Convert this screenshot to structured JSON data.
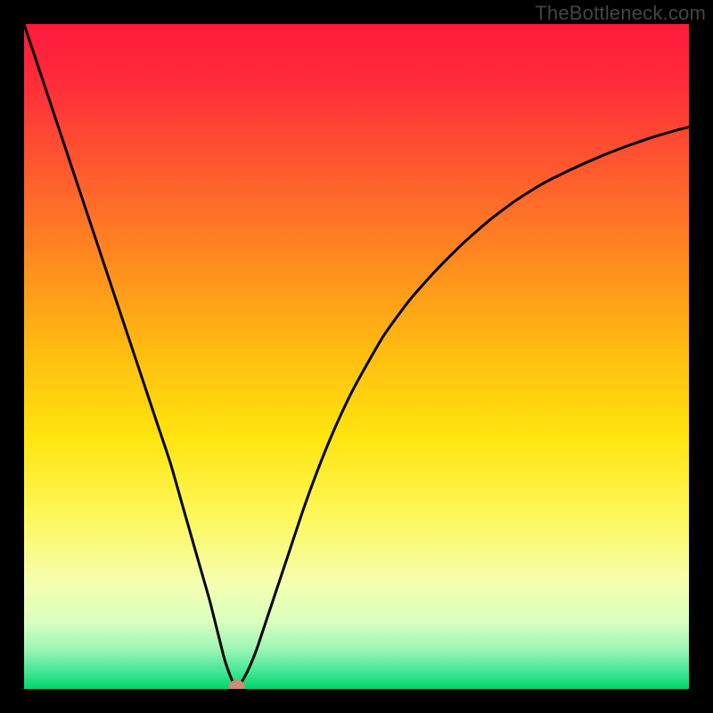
{
  "watermark": "TheBottleneck.com",
  "chart_data": {
    "type": "line",
    "title": "",
    "xlabel": "",
    "ylabel": "",
    "xlim": [
      0,
      100
    ],
    "ylim": [
      0,
      100
    ],
    "grid": false,
    "legend": null,
    "series": [
      {
        "name": "bottleneck-curve",
        "x": [
          0,
          2,
          4,
          6,
          8,
          10,
          12,
          14,
          16,
          18,
          20,
          22,
          24,
          26,
          28,
          30,
          31,
          32,
          33,
          34,
          35,
          36,
          38,
          40,
          42,
          44,
          46,
          48,
          50,
          54,
          58,
          62,
          66,
          70,
          74,
          78,
          82,
          86,
          90,
          94,
          98,
          100
        ],
        "y": [
          100,
          94,
          88,
          82,
          76,
          70,
          64,
          58,
          52,
          46,
          40,
          34,
          27,
          20,
          13,
          5,
          2,
          0,
          1.5,
          3.5,
          6,
          9,
          15,
          21,
          27,
          32.5,
          37.5,
          42,
          46,
          53,
          58.5,
          63,
          67,
          70.5,
          73.5,
          76,
          78,
          79.8,
          81.4,
          82.8,
          84,
          84.5
        ]
      }
    ],
    "marker": {
      "name": "optimal-point",
      "x": 32,
      "y": 0,
      "color": "#d08a77"
    },
    "background": "heatmap-gradient",
    "background_colors": {
      "top": "#ff0033",
      "upper_mid": "#ff8c00",
      "mid": "#ffe600",
      "lower_mid": "#f5ff8a",
      "bottom": "#00e676"
    }
  }
}
